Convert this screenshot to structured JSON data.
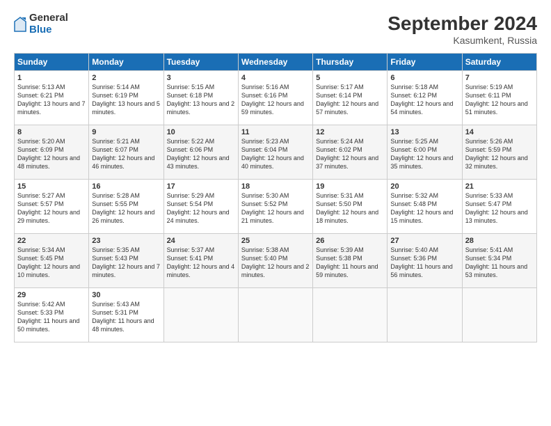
{
  "logo": {
    "general": "General",
    "blue": "Blue"
  },
  "header": {
    "title": "September 2024",
    "subtitle": "Kasumkent, Russia"
  },
  "weekdays": [
    "Sunday",
    "Monday",
    "Tuesday",
    "Wednesday",
    "Thursday",
    "Friday",
    "Saturday"
  ],
  "weeks": [
    [
      {
        "day": "1",
        "info": "Sunrise: 5:13 AM\nSunset: 6:21 PM\nDaylight: 13 hours\nand 7 minutes."
      },
      {
        "day": "2",
        "info": "Sunrise: 5:14 AM\nSunset: 6:19 PM\nDaylight: 13 hours\nand 5 minutes."
      },
      {
        "day": "3",
        "info": "Sunrise: 5:15 AM\nSunset: 6:18 PM\nDaylight: 13 hours\nand 2 minutes."
      },
      {
        "day": "4",
        "info": "Sunrise: 5:16 AM\nSunset: 6:16 PM\nDaylight: 12 hours\nand 59 minutes."
      },
      {
        "day": "5",
        "info": "Sunrise: 5:17 AM\nSunset: 6:14 PM\nDaylight: 12 hours\nand 57 minutes."
      },
      {
        "day": "6",
        "info": "Sunrise: 5:18 AM\nSunset: 6:12 PM\nDaylight: 12 hours\nand 54 minutes."
      },
      {
        "day": "7",
        "info": "Sunrise: 5:19 AM\nSunset: 6:11 PM\nDaylight: 12 hours\nand 51 minutes."
      }
    ],
    [
      {
        "day": "8",
        "info": "Sunrise: 5:20 AM\nSunset: 6:09 PM\nDaylight: 12 hours\nand 48 minutes."
      },
      {
        "day": "9",
        "info": "Sunrise: 5:21 AM\nSunset: 6:07 PM\nDaylight: 12 hours\nand 46 minutes."
      },
      {
        "day": "10",
        "info": "Sunrise: 5:22 AM\nSunset: 6:06 PM\nDaylight: 12 hours\nand 43 minutes."
      },
      {
        "day": "11",
        "info": "Sunrise: 5:23 AM\nSunset: 6:04 PM\nDaylight: 12 hours\nand 40 minutes."
      },
      {
        "day": "12",
        "info": "Sunrise: 5:24 AM\nSunset: 6:02 PM\nDaylight: 12 hours\nand 37 minutes."
      },
      {
        "day": "13",
        "info": "Sunrise: 5:25 AM\nSunset: 6:00 PM\nDaylight: 12 hours\nand 35 minutes."
      },
      {
        "day": "14",
        "info": "Sunrise: 5:26 AM\nSunset: 5:59 PM\nDaylight: 12 hours\nand 32 minutes."
      }
    ],
    [
      {
        "day": "15",
        "info": "Sunrise: 5:27 AM\nSunset: 5:57 PM\nDaylight: 12 hours\nand 29 minutes."
      },
      {
        "day": "16",
        "info": "Sunrise: 5:28 AM\nSunset: 5:55 PM\nDaylight: 12 hours\nand 26 minutes."
      },
      {
        "day": "17",
        "info": "Sunrise: 5:29 AM\nSunset: 5:54 PM\nDaylight: 12 hours\nand 24 minutes."
      },
      {
        "day": "18",
        "info": "Sunrise: 5:30 AM\nSunset: 5:52 PM\nDaylight: 12 hours\nand 21 minutes."
      },
      {
        "day": "19",
        "info": "Sunrise: 5:31 AM\nSunset: 5:50 PM\nDaylight: 12 hours\nand 18 minutes."
      },
      {
        "day": "20",
        "info": "Sunrise: 5:32 AM\nSunset: 5:48 PM\nDaylight: 12 hours\nand 15 minutes."
      },
      {
        "day": "21",
        "info": "Sunrise: 5:33 AM\nSunset: 5:47 PM\nDaylight: 12 hours\nand 13 minutes."
      }
    ],
    [
      {
        "day": "22",
        "info": "Sunrise: 5:34 AM\nSunset: 5:45 PM\nDaylight: 12 hours\nand 10 minutes."
      },
      {
        "day": "23",
        "info": "Sunrise: 5:35 AM\nSunset: 5:43 PM\nDaylight: 12 hours\nand 7 minutes."
      },
      {
        "day": "24",
        "info": "Sunrise: 5:37 AM\nSunset: 5:41 PM\nDaylight: 12 hours\nand 4 minutes."
      },
      {
        "day": "25",
        "info": "Sunrise: 5:38 AM\nSunset: 5:40 PM\nDaylight: 12 hours\nand 2 minutes."
      },
      {
        "day": "26",
        "info": "Sunrise: 5:39 AM\nSunset: 5:38 PM\nDaylight: 11 hours\nand 59 minutes."
      },
      {
        "day": "27",
        "info": "Sunrise: 5:40 AM\nSunset: 5:36 PM\nDaylight: 11 hours\nand 56 minutes."
      },
      {
        "day": "28",
        "info": "Sunrise: 5:41 AM\nSunset: 5:34 PM\nDaylight: 11 hours\nand 53 minutes."
      }
    ],
    [
      {
        "day": "29",
        "info": "Sunrise: 5:42 AM\nSunset: 5:33 PM\nDaylight: 11 hours\nand 50 minutes."
      },
      {
        "day": "30",
        "info": "Sunrise: 5:43 AM\nSunset: 5:31 PM\nDaylight: 11 hours\nand 48 minutes."
      },
      null,
      null,
      null,
      null,
      null
    ]
  ]
}
